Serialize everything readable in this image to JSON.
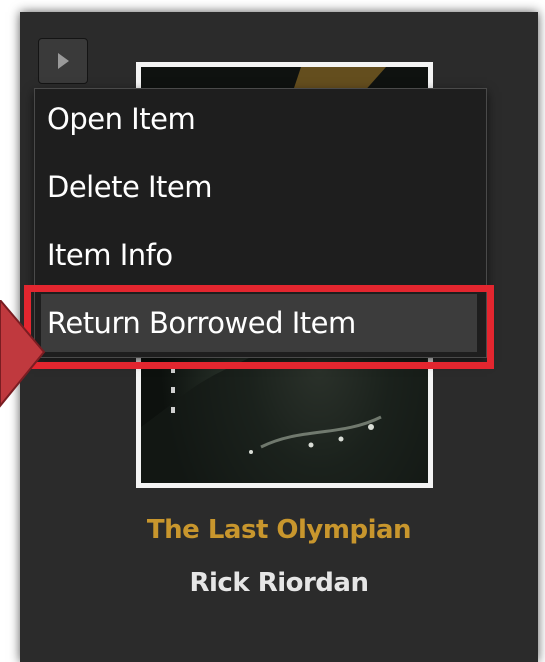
{
  "colors": {
    "panel_bg": "#2b2b2b",
    "menu_bg": "#1e1e1e",
    "menu_text": "#ffffff",
    "title_text": "#c8962d",
    "author_text": "#e6e6e6",
    "highlight": "#e3262f",
    "arrow_fill": "#c0393e"
  },
  "icons": {
    "expand": "triangle-right-icon"
  },
  "context_menu": {
    "items": [
      {
        "label": "Open Item"
      },
      {
        "label": "Delete Item"
      },
      {
        "label": "Item Info"
      },
      {
        "label": "Return Borrowed Item",
        "highlighted": true
      }
    ]
  },
  "book": {
    "title": "The Last Olympian",
    "author": "Rick Riordan"
  }
}
